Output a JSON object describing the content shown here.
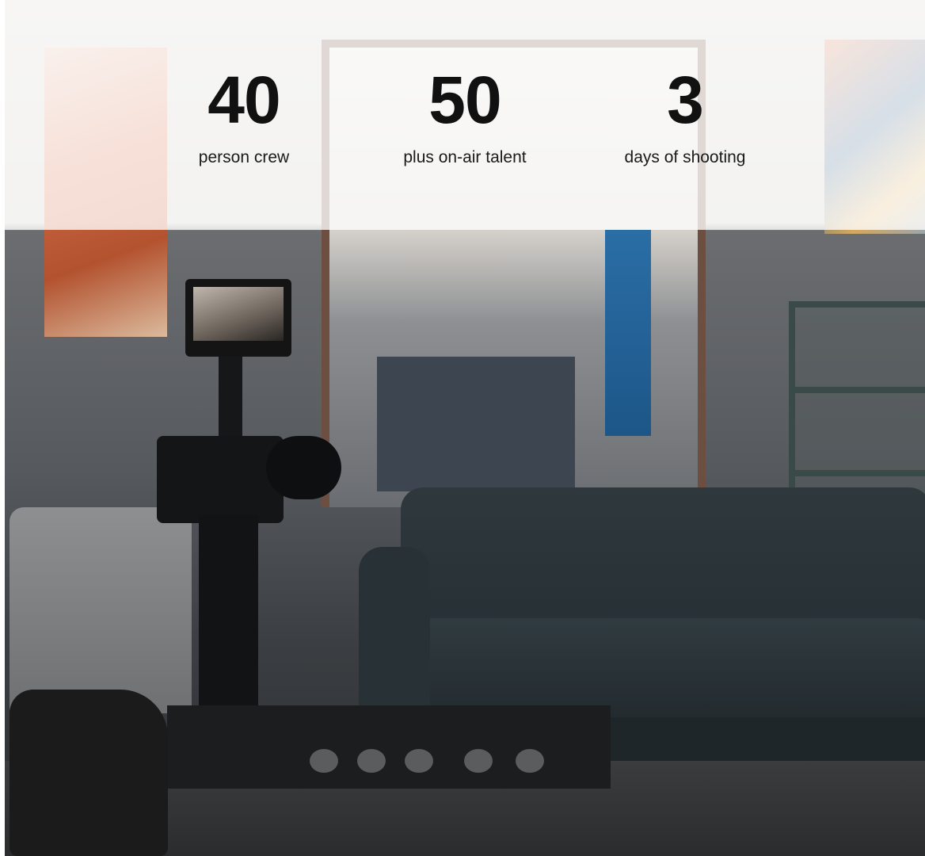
{
  "stats": [
    {
      "value": "40",
      "label": "person crew"
    },
    {
      "value": "50",
      "label": "plus on-air talent"
    },
    {
      "value": "3",
      "label": "days of shooting"
    }
  ],
  "colors": {
    "text": "#111111",
    "overlay": "rgba(255,255,255,0.78)"
  }
}
